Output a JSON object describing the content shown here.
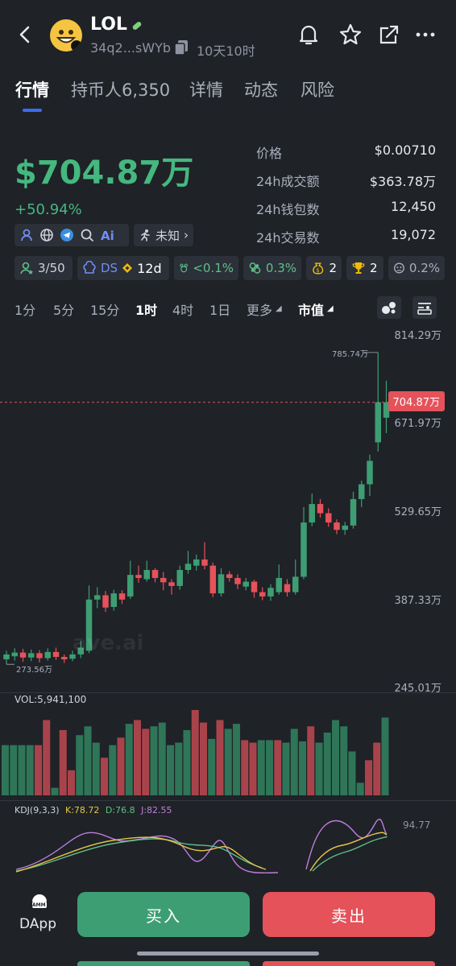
{
  "header": {
    "title": "LOL",
    "address": "34q2...sWYb",
    "age": "10天10时"
  },
  "tabs": [
    {
      "label": "行情",
      "active": true
    },
    {
      "label": "持币人6,350",
      "active": false
    },
    {
      "label": "详情",
      "active": false
    },
    {
      "label": "动态",
      "active": false
    },
    {
      "label": "风险",
      "active": false
    }
  ],
  "market": {
    "market_cap": "$704.87万",
    "change": "+50.94%",
    "tag_unknown": "未知"
  },
  "stats": [
    {
      "label": "价格",
      "value": "$0.00710"
    },
    {
      "label": "24h成交额",
      "value": "$363.78万"
    },
    {
      "label": "24h钱包数",
      "value": "12,450"
    },
    {
      "label": "24h交易数",
      "value": "19,072"
    }
  ],
  "chips": {
    "dev": "3/50",
    "ds": "DS",
    "age": "12d",
    "top": "<0.1%",
    "bundle": "0.3%",
    "bag": "2",
    "trophy": "2",
    "sniper": "0.2%"
  },
  "timeframes": [
    "1分",
    "5分",
    "15分",
    "1时",
    "4时",
    "1日",
    "更多"
  ],
  "active_timeframe": "1时",
  "mcap_toggle": "市值",
  "chart_data": {
    "type": "candlestick",
    "price_labels": [
      "814.29万",
      "671.97万",
      "529.65万",
      "387.33万",
      "245.01万"
    ],
    "current_label": "704.87万",
    "high_label": "785.74万",
    "low_label": "273.56万",
    "y_range": [
      245.01,
      814.29
    ],
    "watermark": "ave.ai",
    "candles": [
      {
        "o": 288,
        "c": 296,
        "h": 302,
        "l": 280
      },
      {
        "o": 293,
        "c": 299,
        "h": 306,
        "l": 286
      },
      {
        "o": 299,
        "c": 291,
        "h": 305,
        "l": 284
      },
      {
        "o": 291,
        "c": 298,
        "h": 304,
        "l": 285
      },
      {
        "o": 298,
        "c": 290,
        "h": 303,
        "l": 283
      },
      {
        "o": 290,
        "c": 300,
        "h": 306,
        "l": 286
      },
      {
        "o": 300,
        "c": 292,
        "h": 307,
        "l": 287
      },
      {
        "o": 292,
        "c": 288,
        "h": 296,
        "l": 282
      },
      {
        "o": 289,
        "c": 296,
        "h": 302,
        "l": 285
      },
      {
        "o": 296,
        "c": 307,
        "h": 318,
        "l": 290
      },
      {
        "o": 302,
        "c": 385,
        "h": 408,
        "l": 298
      },
      {
        "o": 385,
        "c": 392,
        "h": 405,
        "l": 371
      },
      {
        "o": 392,
        "c": 372,
        "h": 399,
        "l": 365
      },
      {
        "o": 373,
        "c": 395,
        "h": 401,
        "l": 367
      },
      {
        "o": 395,
        "c": 385,
        "h": 400,
        "l": 378
      },
      {
        "o": 390,
        "c": 425,
        "h": 448,
        "l": 386
      },
      {
        "o": 425,
        "c": 420,
        "h": 440,
        "l": 412
      },
      {
        "o": 418,
        "c": 433,
        "h": 448,
        "l": 414
      },
      {
        "o": 433,
        "c": 420,
        "h": 436,
        "l": 413
      },
      {
        "o": 420,
        "c": 413,
        "h": 430,
        "l": 400
      },
      {
        "o": 413,
        "c": 407,
        "h": 418,
        "l": 393
      },
      {
        "o": 407,
        "c": 433,
        "h": 440,
        "l": 401
      },
      {
        "o": 433,
        "c": 443,
        "h": 464,
        "l": 427
      },
      {
        "o": 440,
        "c": 450,
        "h": 458,
        "l": 432
      },
      {
        "o": 450,
        "c": 440,
        "h": 478,
        "l": 434
      },
      {
        "o": 440,
        "c": 395,
        "h": 445,
        "l": 389
      },
      {
        "o": 395,
        "c": 426,
        "h": 436,
        "l": 390
      },
      {
        "o": 426,
        "c": 420,
        "h": 431,
        "l": 414
      },
      {
        "o": 420,
        "c": 410,
        "h": 426,
        "l": 402
      },
      {
        "o": 406,
        "c": 414,
        "h": 420,
        "l": 400
      },
      {
        "o": 414,
        "c": 397,
        "h": 417,
        "l": 388
      },
      {
        "o": 397,
        "c": 390,
        "h": 405,
        "l": 384
      },
      {
        "o": 390,
        "c": 404,
        "h": 410,
        "l": 383
      },
      {
        "o": 397,
        "c": 420,
        "h": 442,
        "l": 393
      },
      {
        "o": 410,
        "c": 397,
        "h": 418,
        "l": 390
      },
      {
        "o": 397,
        "c": 422,
        "h": 450,
        "l": 393
      },
      {
        "o": 422,
        "c": 510,
        "h": 535,
        "l": 418
      },
      {
        "o": 510,
        "c": 540,
        "h": 557,
        "l": 504
      },
      {
        "o": 540,
        "c": 525,
        "h": 548,
        "l": 518
      },
      {
        "o": 525,
        "c": 510,
        "h": 533,
        "l": 503
      },
      {
        "o": 510,
        "c": 498,
        "h": 515,
        "l": 491
      },
      {
        "o": 498,
        "c": 505,
        "h": 511,
        "l": 490
      },
      {
        "o": 505,
        "c": 548,
        "h": 560,
        "l": 500
      },
      {
        "o": 548,
        "c": 572,
        "h": 578,
        "l": 535
      },
      {
        "o": 572,
        "c": 610,
        "h": 620,
        "l": 553
      },
      {
        "o": 640,
        "c": 705,
        "h": 785.74,
        "l": 625
      },
      {
        "o": 680,
        "c": 705,
        "h": 740,
        "l": 655
      }
    ],
    "volume_label": "VOL:5,941,100",
    "volume": [
      {
        "v": 40,
        "up": true
      },
      {
        "v": 40,
        "up": true
      },
      {
        "v": 40,
        "up": true
      },
      {
        "v": 40,
        "up": true
      },
      {
        "v": 40,
        "up": false
      },
      {
        "v": 60,
        "up": false
      },
      {
        "v": 6,
        "up": true
      },
      {
        "v": 52,
        "up": false
      },
      {
        "v": 20,
        "up": false
      },
      {
        "v": 48,
        "up": true
      },
      {
        "v": 55,
        "up": true
      },
      {
        "v": 42,
        "up": true
      },
      {
        "v": 30,
        "up": false
      },
      {
        "v": 40,
        "up": true
      },
      {
        "v": 46,
        "up": false
      },
      {
        "v": 57,
        "up": true
      },
      {
        "v": 60,
        "up": false
      },
      {
        "v": 53,
        "up": false
      },
      {
        "v": 55,
        "up": true
      },
      {
        "v": 58,
        "up": true
      },
      {
        "v": 40,
        "up": true
      },
      {
        "v": 42,
        "up": true
      },
      {
        "v": 52,
        "up": true
      },
      {
        "v": 68,
        "up": false
      },
      {
        "v": 58,
        "up": false
      },
      {
        "v": 45,
        "up": true
      },
      {
        "v": 60,
        "up": false
      },
      {
        "v": 53,
        "up": true
      },
      {
        "v": 57,
        "up": true
      },
      {
        "v": 44,
        "up": false
      },
      {
        "v": 42,
        "up": false
      },
      {
        "v": 44,
        "up": true
      },
      {
        "v": 44,
        "up": true
      },
      {
        "v": 44,
        "up": false
      },
      {
        "v": 42,
        "up": true
      },
      {
        "v": 53,
        "up": true
      },
      {
        "v": 43,
        "up": true
      },
      {
        "v": 55,
        "up": false
      },
      {
        "v": 42,
        "up": true
      },
      {
        "v": 50,
        "up": true
      },
      {
        "v": 60,
        "up": true
      },
      {
        "v": 55,
        "up": true
      },
      {
        "v": 35,
        "up": true
      },
      {
        "v": 10,
        "up": true
      },
      {
        "v": 28,
        "up": false
      },
      {
        "v": 42,
        "up": false
      },
      {
        "v": 62,
        "up": true
      }
    ],
    "kdj_label": "KDJ(9,3,3)",
    "kdj_k": "K:78.72",
    "kdj_d": "D:76.8",
    "kdj_j": "J:82.55",
    "kdj_right_label": "94.77"
  },
  "actions": {
    "dapp_badge": "AMM",
    "dapp": "DApp",
    "buy": "买入",
    "sell": "卖出"
  },
  "colors": {
    "up": "#3d9e73",
    "down": "#e5525a",
    "bg": "#1f2227",
    "accent": "#3b6cf0"
  }
}
